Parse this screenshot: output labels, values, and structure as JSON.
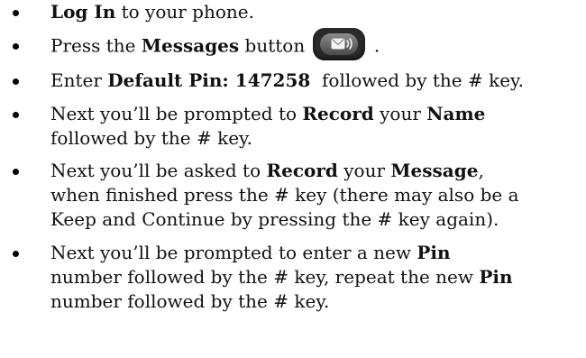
{
  "steps": [
    {
      "before": "",
      "bold": "Log In",
      "after": " to your phone."
    },
    {
      "text1": "Press the ",
      "bold1": "Messages",
      "text2": " button",
      "icon": "messages-envelope-icon",
      "text3": " ."
    },
    {
      "text1": "Enter ",
      "bold1": "Default Pin: 147258",
      "text2": "  followed by the # key."
    },
    {
      "line1_text1": "Next you’ll be prompted to ",
      "line1_bold1": "Record",
      "line1_text2": " your ",
      "line1_bold2": "Name",
      "line2": "followed by the # key."
    },
    {
      "line1_text1": "Next you’ll be asked to ",
      "line1_bold1": "Record",
      "line1_text2": " your ",
      "line1_bold2": "Message",
      "line1_text3": ",",
      "line2": "when finished press the # key (there may also be a",
      "line3": "Keep and Continue by pressing the # key again)."
    },
    {
      "line1_text1": "Next you’ll be prompted to enter a new ",
      "line1_bold1": "Pin",
      "line2_text1": "number followed by the # key, repeat the new ",
      "line2_bold1": "Pin",
      "line3": "number followed by the # key."
    }
  ]
}
